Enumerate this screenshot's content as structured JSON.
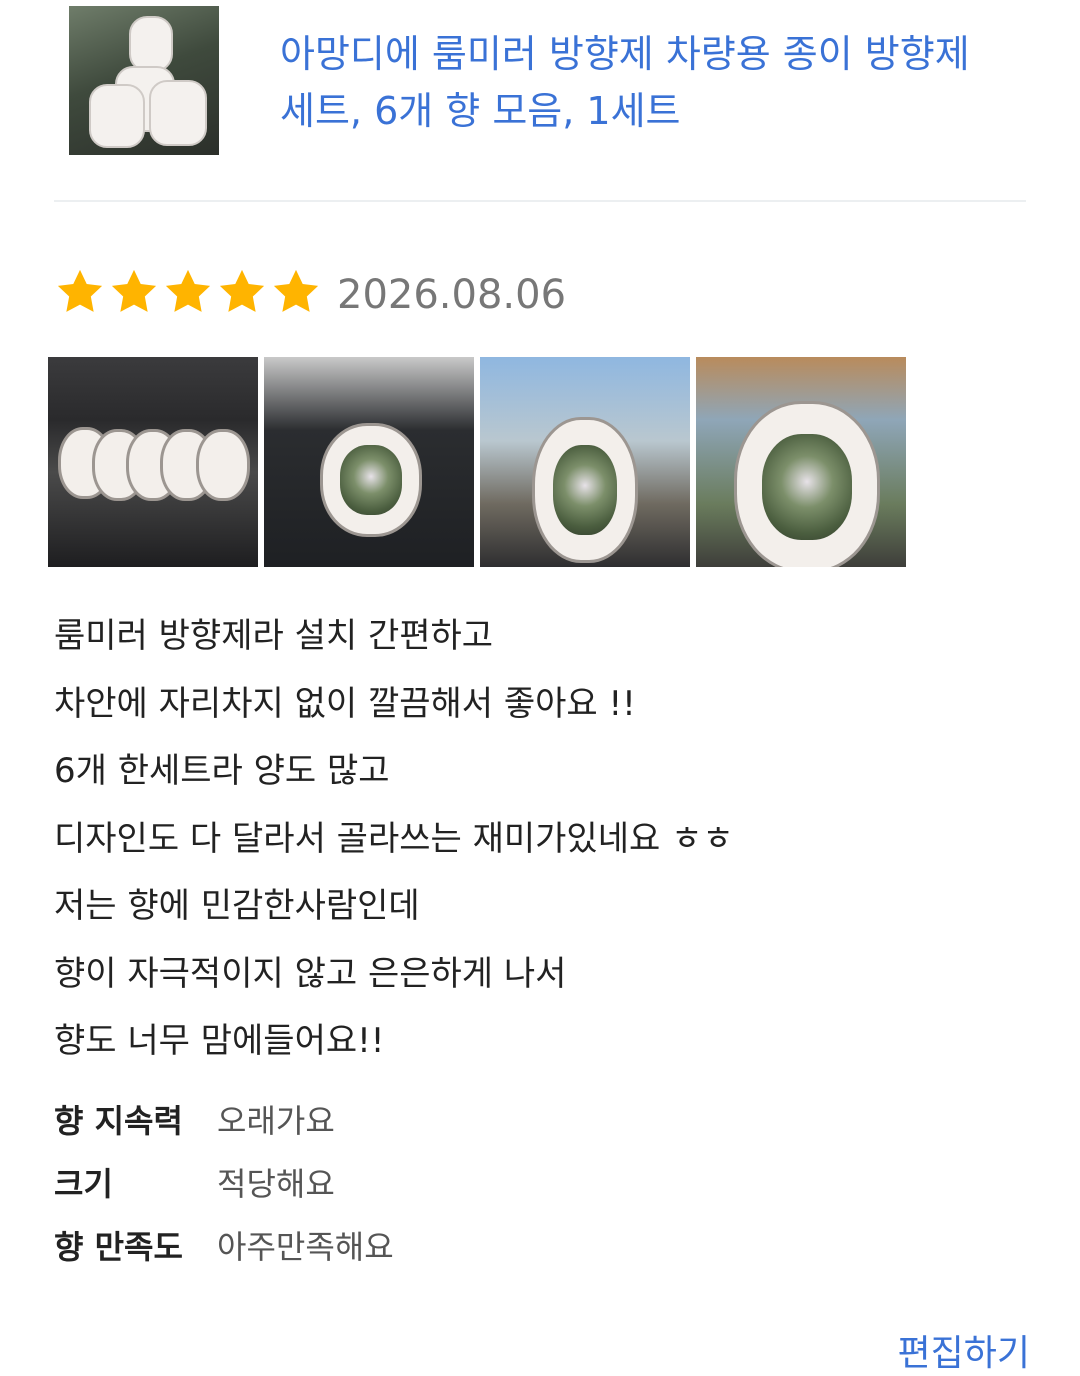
{
  "product": {
    "thumbnail": "car-air-freshener-product-thumbnail",
    "title": "아망디에 룸미러 방향제 차량용 종이 방향제 세트, 6개 향 모음, 1세트"
  },
  "review": {
    "rating": 5,
    "rating_max": 5,
    "star_color": "#FFB400",
    "date": "2026.08.06",
    "photos": [
      "air-freshener-packages-on-dashboard-photo",
      "air-freshener-in-hand-photo",
      "air-freshener-hanging-on-mirror-photo",
      "air-freshener-closeup-photo"
    ],
    "text_lines": [
      "룸미러 방향제라 설치 간편하고",
      "차안에 자리차지 없이 깔끔해서 좋아요 !!",
      "6개 한세트라 양도 많고",
      "디자인도 다 달라서 골라쓰는 재미가있네요 ㅎㅎ",
      "저는 향에 민감한사람인데",
      "향이 자극적이지 않고 은은하게 나서",
      "향도 너무 맘에들어요!!"
    ],
    "attributes": [
      {
        "label": "향 지속력",
        "value": "오래가요"
      },
      {
        "label": "크기",
        "value": "적당해요"
      },
      {
        "label": "향 만족도",
        "value": "아주만족해요"
      }
    ]
  },
  "actions": {
    "edit_label": "편집하기"
  },
  "colors": {
    "link": "#3A72D6",
    "divider": "#ECEFF1",
    "date": "#777777"
  }
}
